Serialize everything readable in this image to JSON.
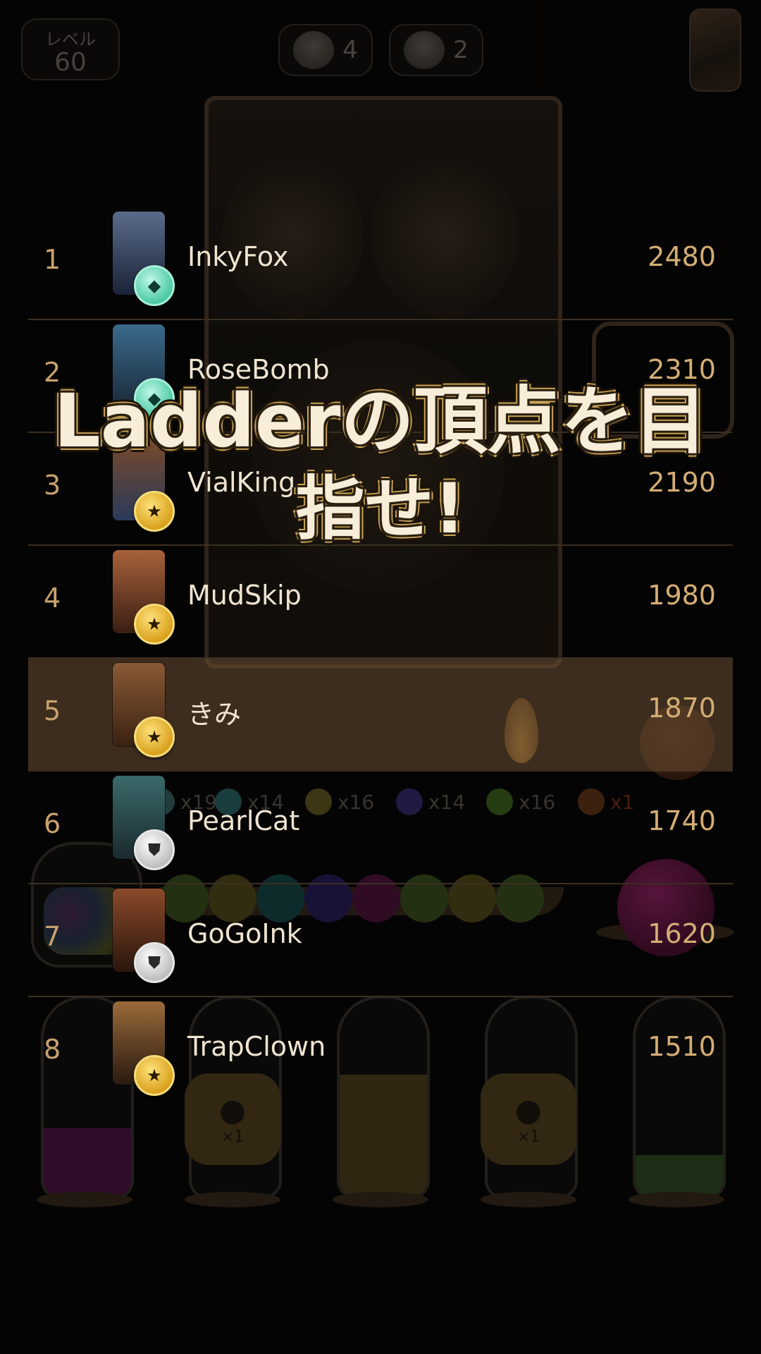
{
  "hud": {
    "level_label": "レベル",
    "level_value": "60",
    "counter_a_icon": "octopus-creature-icon",
    "counter_a": "4",
    "counter_b_icon": "robot-head-icon",
    "counter_b": "2"
  },
  "headline": {
    "line1": "Ladderの頂点を目",
    "line2": "指せ!"
  },
  "tallies": [
    {
      "color": "#2a4a4a",
      "label": "x19"
    },
    {
      "color": "#1f4a4a",
      "label": "x14"
    },
    {
      "color": "#4a4219",
      "label": "x16"
    },
    {
      "color": "#2a2052",
      "label": "x14"
    },
    {
      "color": "#2f4a18",
      "label": "x16"
    },
    {
      "color": "#4a2a12",
      "label": "x1"
    }
  ],
  "drop_badges": [
    {
      "label": "×1"
    },
    {
      "label": "×1"
    }
  ],
  "leaderboard": [
    {
      "rank": "1",
      "name": "InkyFox",
      "score": "2480",
      "badge": "diamond",
      "badge_icon": "diamond-icon",
      "portrait": [
        "#5a6c8a",
        "#1a2338"
      ]
    },
    {
      "rank": "2",
      "name": "RoseBomb",
      "score": "2310",
      "badge": "diamond",
      "badge_icon": "diamond-icon",
      "portrait": [
        "#3a6a8c",
        "#1a2a3a"
      ]
    },
    {
      "rank": "3",
      "name": "VialKing",
      "score": "2190",
      "badge": "gold",
      "badge_icon": "star-icon",
      "portrait": [
        "#7a4a2a",
        "#2a3a5a"
      ]
    },
    {
      "rank": "4",
      "name": "MudSkip",
      "score": "1980",
      "badge": "gold",
      "badge_icon": "star-icon",
      "portrait": [
        "#a8623a",
        "#3a1e12"
      ]
    },
    {
      "rank": "5",
      "name": "きみ",
      "score": "1870",
      "badge": "gold",
      "badge_icon": "star-icon",
      "portrait": [
        "#8a5a34",
        "#3a2212"
      ],
      "highlight": true
    },
    {
      "rank": "6",
      "name": "PearlCat",
      "score": "1740",
      "badge": "silver",
      "badge_icon": "shield-icon",
      "portrait": [
        "#3a6a6a",
        "#1a2a2e"
      ]
    },
    {
      "rank": "7",
      "name": "GoGoInk",
      "score": "1620",
      "badge": "silver",
      "badge_icon": "shield-icon",
      "portrait": [
        "#8a4a2a",
        "#2a160c"
      ]
    },
    {
      "rank": "8",
      "name": "TrapClown",
      "score": "1510",
      "badge": "gold",
      "badge_icon": "star-icon",
      "portrait": [
        "#9a6a3a",
        "#2a1a10"
      ]
    }
  ]
}
